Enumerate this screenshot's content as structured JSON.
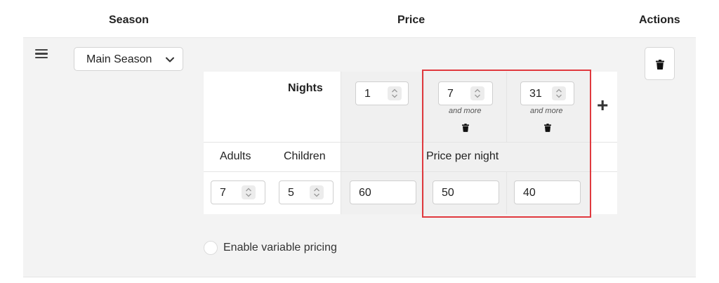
{
  "header": {
    "season": "Season",
    "price": "Price",
    "actions": "Actions"
  },
  "season_row": {
    "season_select_value": "Main Season"
  },
  "matrix": {
    "nights_label": "Nights",
    "adults_label": "Adults",
    "children_label": "Children",
    "price_per_night_label": "Price per night",
    "night_columns": [
      {
        "nights": "1",
        "and_more": ""
      },
      {
        "nights": "7",
        "and_more": "and more"
      },
      {
        "nights": "31",
        "and_more": "and more"
      }
    ],
    "row": {
      "adults": "7",
      "children": "5",
      "prices": [
        "60",
        "50",
        "40"
      ]
    },
    "add_column_symbol": "+"
  },
  "variable_pricing": {
    "label": "Enable variable pricing",
    "enabled": false
  },
  "icons": {
    "drag": "drag-handle-icon",
    "chevron": "chevron-down-icon",
    "trash": "trash-icon",
    "plus": "plus-icon",
    "spinner": "spinner-arrows-icon"
  },
  "colors": {
    "highlight": "#e0393e",
    "row_background": "#f3f3f3",
    "shaded_cell": "#f0f0f0"
  }
}
